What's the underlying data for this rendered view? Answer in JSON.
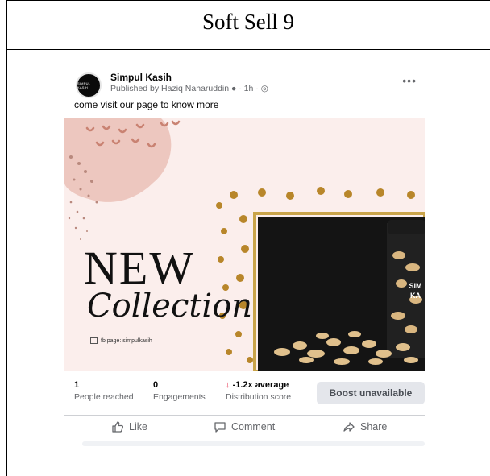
{
  "document": {
    "title": "Soft Sell 9"
  },
  "post": {
    "page_name": "Simpul Kasih",
    "avatar_text": "SIMPUL KASIH",
    "published_line": "Published by Haziq Naharuddin ● · 1h · ◎",
    "more_label": "•••",
    "caption": "come visit our page to know more",
    "image": {
      "headline": "NEW",
      "subline": "Collection",
      "fb_page_label": "fb page: simpulkasih",
      "jar_label": "SIM KA"
    },
    "stats": {
      "reached": {
        "value": "1",
        "label": "People reached"
      },
      "engagements": {
        "value": "0",
        "label": "Engagements"
      },
      "distribution": {
        "value": "-1.2x average",
        "label": "Distribution score",
        "arrow": "↓"
      }
    },
    "boost_label": "Boost unavailable",
    "actions": {
      "like": "Like",
      "comment": "Comment",
      "share": "Share"
    }
  },
  "colors": {
    "meta": "#65676b",
    "down_arrow": "#e41e3f",
    "gold": "#b8862a",
    "pink_bg": "#fbeeec",
    "button_bg": "#e4e6eb"
  }
}
